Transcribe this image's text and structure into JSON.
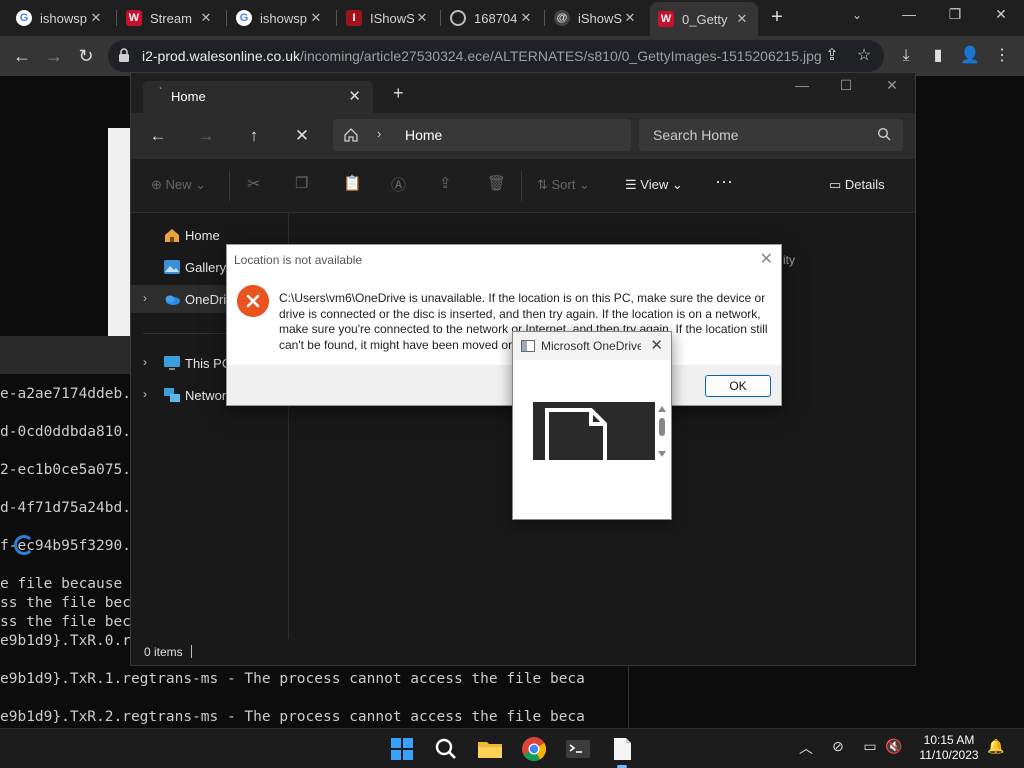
{
  "browser": {
    "tabs": [
      {
        "title": "ishowsp",
        "icon": "google-icon"
      },
      {
        "title": "Stream",
        "icon": "walesonline-icon"
      },
      {
        "title": "ishowsp",
        "icon": "google-icon"
      },
      {
        "title": "IShowS",
        "icon": "ishowspeed-icon"
      },
      {
        "title": "168704",
        "icon": "globe-icon"
      },
      {
        "title": "iShowS",
        "icon": "threads-icon"
      },
      {
        "title": "0_Getty",
        "icon": "walesonline-icon"
      }
    ],
    "url_host": "i2-prod.walesonline.co.uk",
    "url_path": "/incoming/article27530324.ece/ALTERNATES/s810/0_GettyImages-1515206215.jpg"
  },
  "terminal": {
    "lines": [
      "e-a2ae7174ddeb.",
      "d-0cd0ddbda810.",
      "2-ec1b0ce5a075.",
      "d-4f71d75a24bd.",
      "f-ec94b95f3290.",
      "e file because",
      "ss the file bec",
      "ss the file bec",
      "e9b1d9}.TxR.0.r",
      "e9b1d9}.TxR.1.regtrans-ms - The process cannot access the file beca",
      "e9b1d9}.TxR.2.regtrans-ms - The process cannot access the file beca"
    ]
  },
  "explorer": {
    "tab_title": "Home",
    "breadcrumb": "Home",
    "search_placeholder": "Search Home",
    "commands": {
      "new": "New",
      "sort": "Sort",
      "view": "View",
      "details": "Details"
    },
    "sidebar": [
      {
        "label": "Home",
        "icon": "home-icon"
      },
      {
        "label": "Gallery",
        "icon": "gallery-icon"
      },
      {
        "label": "OneDrive",
        "icon": "onedrive-icon"
      },
      {
        "label": "This PC",
        "icon": "this-pc-icon"
      },
      {
        "label": "Network",
        "icon": "network-icon"
      }
    ],
    "partial_text": "ity",
    "status": "0 items"
  },
  "location_dialog": {
    "title": "Location is not available",
    "message": "C:\\Users\\vm6\\OneDrive is unavailable. If the location is on this PC, make sure the device or drive is connected or the disc is inserted, and then try again. If the location is on a network, make sure you're connected to the network or Internet, and then try again. If the location still can't be found, it might have been moved or deleted.",
    "ok_label": "OK"
  },
  "onedrive_dialog": {
    "title": "Microsoft OneDrive"
  },
  "taskbar": {
    "time": "10:15 AM",
    "date": "11/10/2023"
  },
  "colors": {
    "accent": "#0067c0",
    "error": "#e8531f",
    "explorer_bg": "#191919"
  }
}
